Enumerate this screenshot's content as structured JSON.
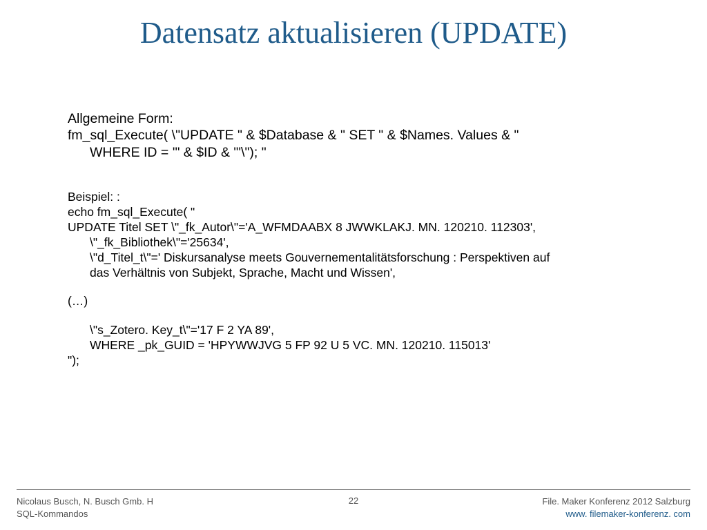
{
  "title": "Datensatz aktualisieren (UPDATE)",
  "section1": {
    "line1": "Allgemeine Form:",
    "line2": "fm_sql_Execute( \\\"UPDATE \" & $Database & \" SET  \" & $Names. Values  & \"",
    "line3": "WHERE ID = '\" & $ID & \"'\\\"); \""
  },
  "section2": {
    "line1": "Beispiel: :",
    "line2": "echo fm_sql_Execute( \"",
    "line3": " UPDATE Titel SET  \\\"_fk_Autor\\\"='A_WFMDAABX 8 JWWKLAKJ. MN. 120210. 112303',",
    "line4": "\\\"_fk_Bibliothek\\\"='25634',",
    "line5": "\\\"d_Titel_t\\\"=' Diskursanalyse meets Gouvernementalitätsforschung : Perspektiven auf",
    "line6": "das Verhältnis von Subjekt, Sprache, Macht und Wissen',"
  },
  "ellipsis": "(…)",
  "section3": {
    "line1": "\\\"s_Zotero. Key_t\\\"='17 F 2 YA 89',",
    "line2": "WHERE _pk_GUID = 'HPYWWJVG 5 FP 92 U 5 VC. MN. 120210. 115013'",
    "line3": "\");"
  },
  "footer": {
    "left1": "Nicolaus Busch, N. Busch Gmb. H",
    "left2": "SQL-Kommandos",
    "center": "22",
    "right1": "File. Maker Konferenz 2012 Salzburg",
    "right2": "www. filemaker-konferenz. com"
  }
}
